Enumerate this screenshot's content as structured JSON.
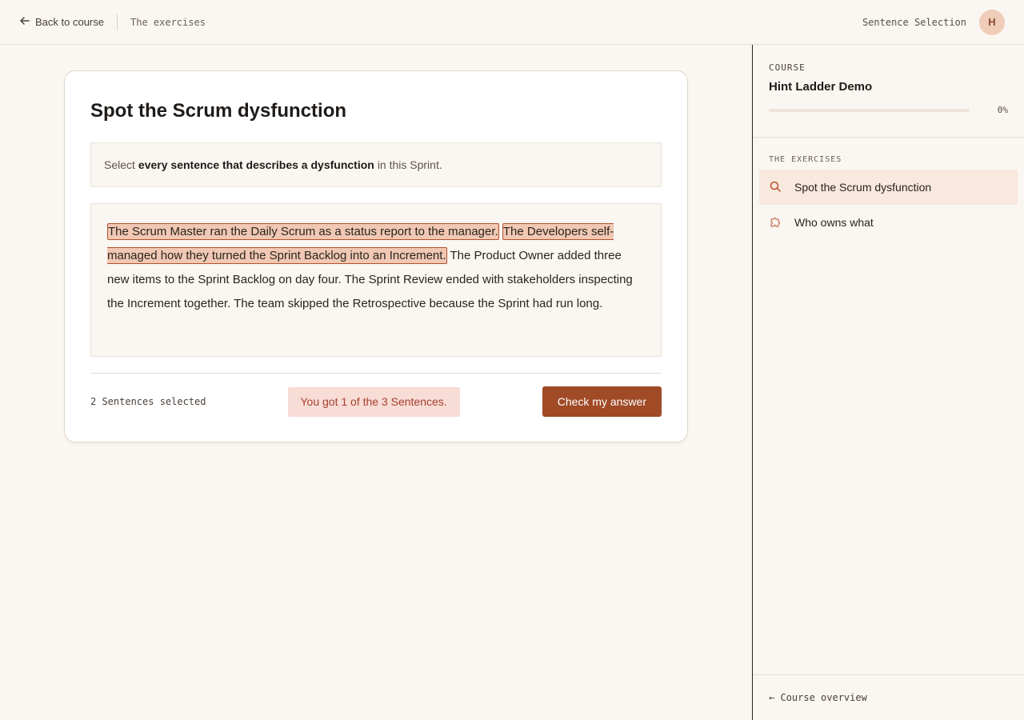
{
  "topbar": {
    "back_label": "Back to course",
    "breadcrumb": "The exercises",
    "mode_label": "Sentence Selection",
    "avatar_initial": "H"
  },
  "exercise": {
    "title": "Spot the Scrum dysfunction",
    "instruction_prefix": "Select",
    "instruction_bold": "every sentence that describes a dysfunction",
    "instruction_suffix": "in this Sprint.",
    "sentences": [
      {
        "text": "The Scrum Master ran the Daily Scrum as a status report to the manager.",
        "selected": true
      },
      {
        "text": "The Developers self-managed how they turned the Sprint Backlog into an Increment.",
        "selected": true
      },
      {
        "text": "The Product Owner added three new items to the Sprint Backlog on day four.",
        "selected": false
      },
      {
        "text": "The Sprint Review ended with stakeholders inspecting the Increment together.",
        "selected": false
      },
      {
        "text": "The team skipped the Retrospective because the Sprint had run long.",
        "selected": false
      }
    ],
    "selected_count_label": "2 Sentences selected",
    "feedback": "You got 1 of the 3 Sentences.",
    "check_button": "Check my answer"
  },
  "sidebar": {
    "course_label": "COURSE",
    "course_title": "Hint Ladder Demo",
    "progress_percent": 0,
    "progress_label": "0%",
    "exercises_heading": "THE EXERCISES",
    "exercises": [
      {
        "label": "Spot the Scrum dysfunction",
        "icon": "search-icon",
        "active": true
      },
      {
        "label": "Who owns what",
        "icon": "puzzle-icon",
        "active": false
      }
    ],
    "footer_link": "← Course overview"
  },
  "colors": {
    "accent": "#a04a26",
    "highlight": "#f0c8b3",
    "feedback_bg": "#f8dcd6",
    "feedback_text": "#a6402d"
  }
}
